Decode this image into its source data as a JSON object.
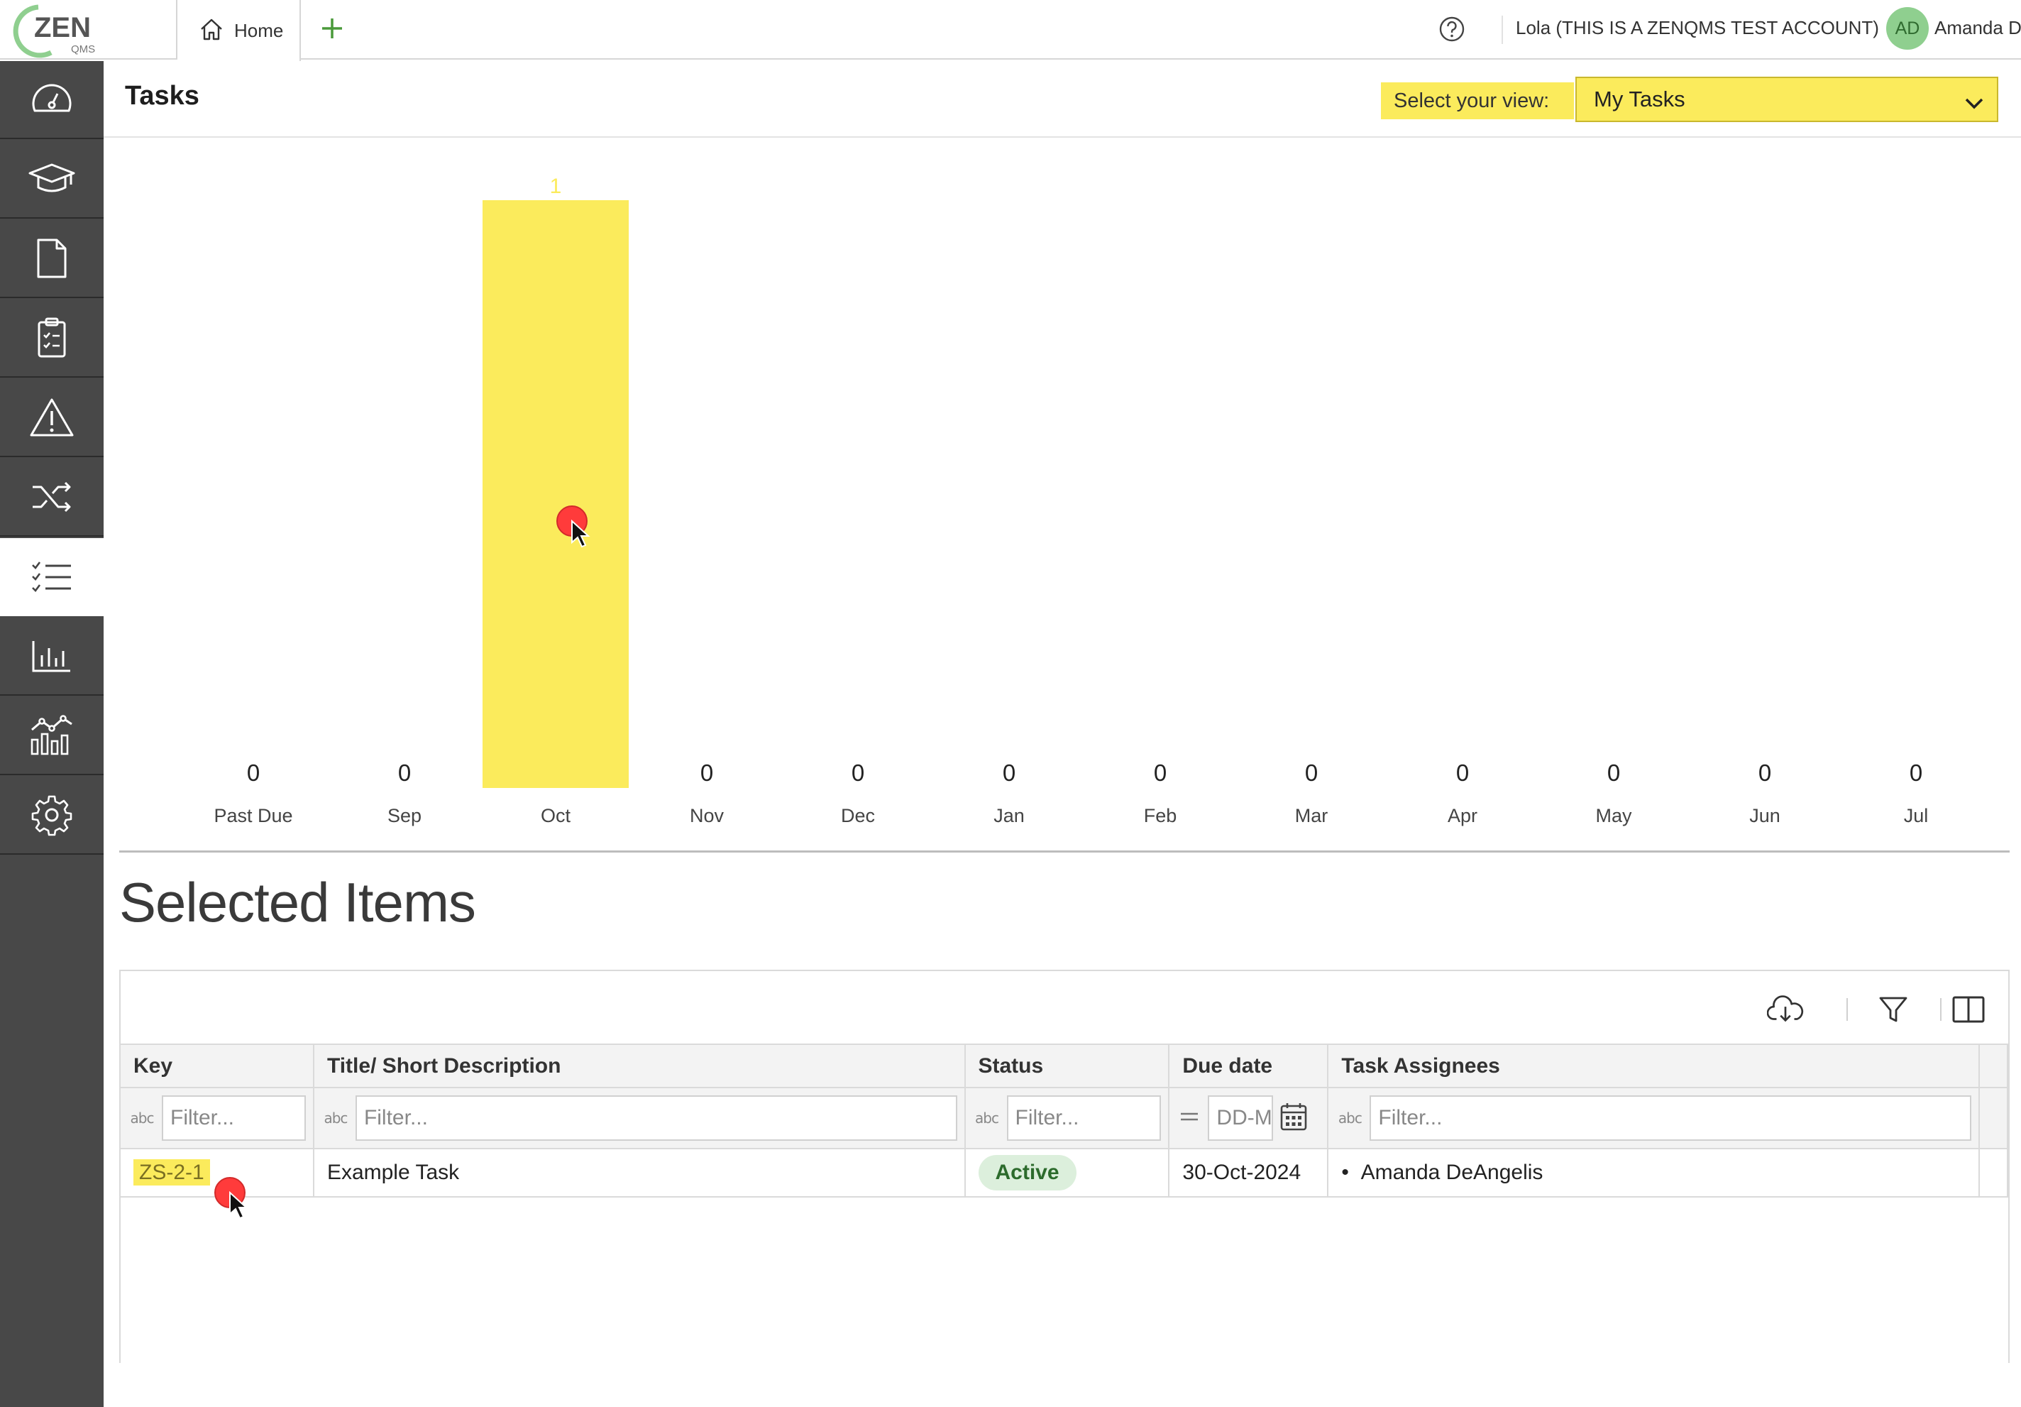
{
  "topbar": {
    "logo_text": "ZEN",
    "logo_sub": "QMS",
    "home_tab_label": "Home",
    "account_label": "Lola (THIS IS A ZENQMS TEST ACCOUNT)",
    "avatar_initials": "AD",
    "user_name": "Amanda D"
  },
  "sidebar": {
    "items": [
      {
        "icon": "dashboard-gauge-icon",
        "active": false
      },
      {
        "icon": "training-cap-icon",
        "active": false
      },
      {
        "icon": "document-icon",
        "active": false
      },
      {
        "icon": "clipboard-checklist-icon",
        "active": false
      },
      {
        "icon": "warning-triangle-icon",
        "active": false
      },
      {
        "icon": "shuffle-icon",
        "active": false
      },
      {
        "icon": "tasks-list-icon",
        "active": true
      },
      {
        "icon": "bar-chart-icon",
        "active": false
      },
      {
        "icon": "analytics-chart-icon",
        "active": false
      },
      {
        "icon": "settings-gear-icon",
        "active": false
      }
    ]
  },
  "page": {
    "title": "Tasks",
    "view_label": "Select your view:",
    "view_value": "My Tasks"
  },
  "chart_data": {
    "type": "bar",
    "categories": [
      "Past Due",
      "Sep",
      "Oct",
      "Nov",
      "Dec",
      "Jan",
      "Feb",
      "Mar",
      "Apr",
      "May",
      "Jun",
      "Jul"
    ],
    "values": [
      0,
      0,
      1,
      0,
      0,
      0,
      0,
      0,
      0,
      0,
      0,
      0
    ],
    "data_labels": true,
    "bar_color": "#fbeb5c",
    "ylim": [
      0,
      1
    ],
    "grid": false
  },
  "selected_items": {
    "title": "Selected Items",
    "columns": [
      "Key",
      "Title/ Short Description",
      "Status",
      "Due date",
      "Task Assignees"
    ],
    "filter_placeholder": "Filter...",
    "date_placeholder": "DD-M",
    "rows": [
      {
        "key": "ZS-2-1",
        "title": "Example Task",
        "status": "Active",
        "due_date": "30-Oct-2024",
        "assignees": [
          "Amanda DeAngelis"
        ]
      }
    ]
  },
  "colors": {
    "highlight": "#fbeb5c",
    "sidebar": "#484848",
    "status_active_bg": "#dcefdc",
    "brand_green": "#5aa05a"
  }
}
